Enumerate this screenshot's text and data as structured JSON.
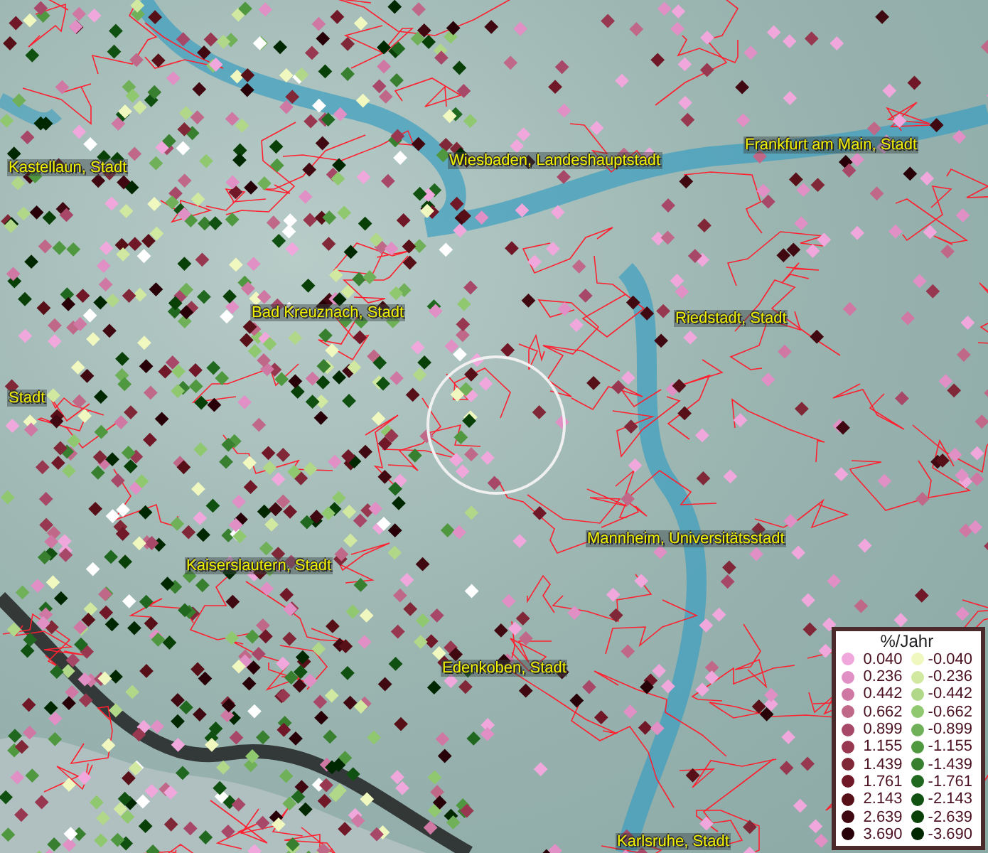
{
  "map": {
    "places": [
      {
        "name": "Kastellaun, Stadt"
      },
      {
        "name": "Wiesbaden, Landeshauptstadt"
      },
      {
        "name": "Frankfurt am Main, Stadt"
      },
      {
        "name": "Bad Kreuznach, Stadt"
      },
      {
        "name": "Riedstadt, Stadt"
      },
      {
        "name": "Stadt"
      },
      {
        "name": "Mannheim, Universitätsstadt"
      },
      {
        "name": "Kaiserslautern, Stadt"
      },
      {
        "name": "Edenkoben, Stadt"
      },
      {
        "name": "Karlsruhe, Stadt"
      }
    ]
  },
  "legend": {
    "title": "%/Jahr",
    "positive": [
      {
        "label": "0.040",
        "color": "#f0a8dc"
      },
      {
        "label": "0.236",
        "color": "#e090c4"
      },
      {
        "label": "0.442",
        "color": "#d078a4"
      },
      {
        "label": "0.662",
        "color": "#c06888"
      },
      {
        "label": "0.899",
        "color": "#a84868"
      },
      {
        "label": "1.155",
        "color": "#983850"
      },
      {
        "label": "1.439",
        "color": "#802838"
      },
      {
        "label": "1.761",
        "color": "#701828"
      },
      {
        "label": "2.143",
        "color": "#581018"
      },
      {
        "label": "2.639",
        "color": "#400810"
      },
      {
        "label": "3.690",
        "color": "#280008"
      }
    ],
    "negative": [
      {
        "label": "-0.040",
        "color": "#f0f8c0"
      },
      {
        "label": "-0.236",
        "color": "#d0e8a0"
      },
      {
        "label": "-0.442",
        "color": "#b0d888"
      },
      {
        "label": "-0.662",
        "color": "#90c870"
      },
      {
        "label": "-0.899",
        "color": "#70b058"
      },
      {
        "label": "-1.155",
        "color": "#509840"
      },
      {
        "label": "-1.439",
        "color": "#388030"
      },
      {
        "label": "-1.761",
        "color": "#206820"
      },
      {
        "label": "-2.143",
        "color": "#105010"
      },
      {
        "label": "-2.639",
        "color": "#084008"
      },
      {
        "label": "-3.690",
        "color": "#002800"
      }
    ]
  }
}
